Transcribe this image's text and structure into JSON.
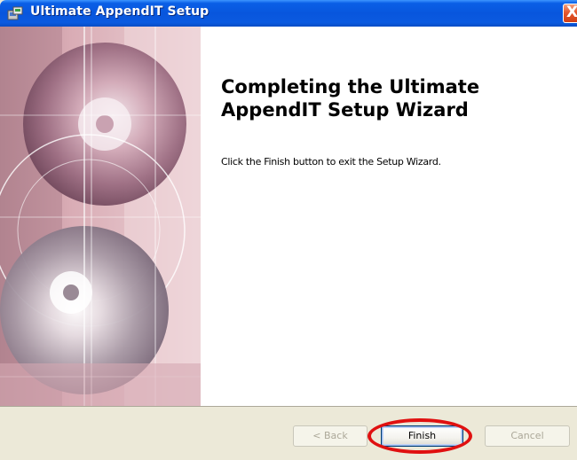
{
  "window": {
    "title": "Ultimate AppendIT Setup",
    "close_glyph": "X",
    "app_icon": "installer-icon"
  },
  "wizard": {
    "heading_line1": "Completing the Ultimate",
    "heading_line2": "AppendIT Setup Wizard",
    "description": "Click the Finish button to exit the Setup Wizard."
  },
  "buttons": {
    "back_label": "< Back",
    "finish_label": "Finish",
    "cancel_label": "Cancel"
  },
  "colors": {
    "titlebar": "#0856dd",
    "highlight_ring": "#e01010",
    "art_pink": "#d9a9b3"
  }
}
